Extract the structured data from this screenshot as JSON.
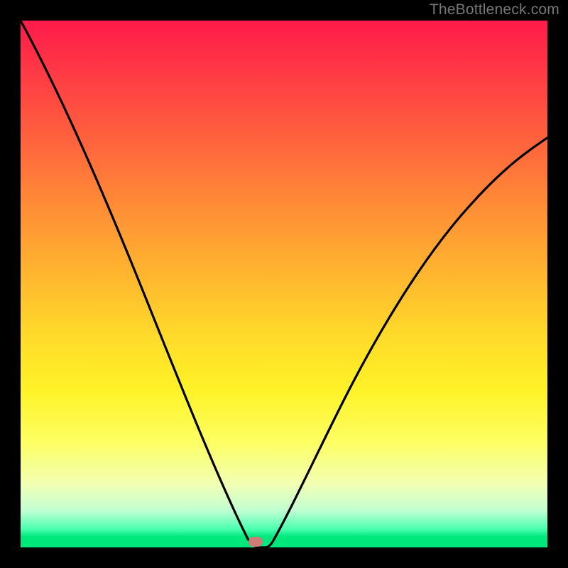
{
  "watermark": "TheBottleneck.com",
  "chart_data": {
    "type": "line",
    "title": "",
    "xlabel": "",
    "ylabel": "",
    "xlim": [
      0,
      100
    ],
    "ylim": [
      0,
      100
    ],
    "x": [
      0,
      5,
      10,
      15,
      20,
      25,
      30,
      35,
      40,
      44,
      45,
      46,
      50,
      55,
      60,
      65,
      70,
      75,
      80,
      85,
      90,
      95,
      100
    ],
    "values": [
      100,
      91,
      80,
      69,
      58,
      47,
      36,
      24,
      12,
      1,
      0,
      1,
      10,
      20,
      30,
      38,
      46,
      53,
      59,
      65,
      70,
      74,
      78
    ],
    "minimum_at_x": 45,
    "marker": {
      "x": 45,
      "y": 0,
      "color": "#cf7b77"
    },
    "background_gradient": [
      "#ff1a4a",
      "#ffdb2a",
      "#fdff63",
      "#00e77c"
    ],
    "grid": false,
    "legend": false
  }
}
